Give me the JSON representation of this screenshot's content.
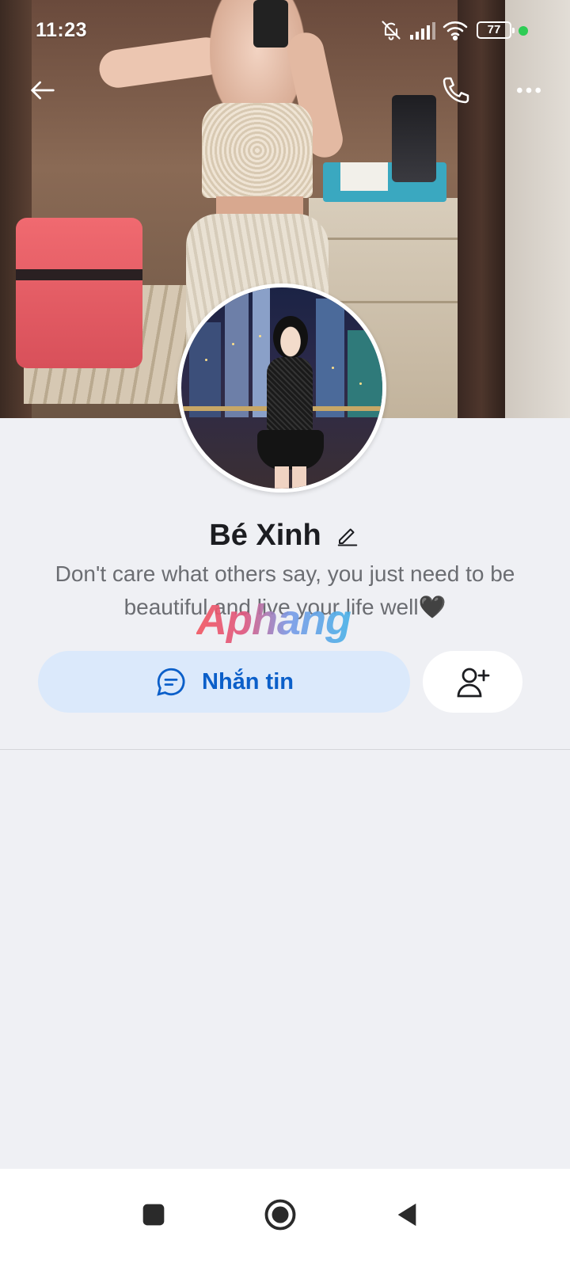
{
  "status_bar": {
    "time": "11:23",
    "battery": "77",
    "icons": [
      "bell-off-icon",
      "signal-icon",
      "wifi-icon",
      "battery-icon"
    ],
    "dot_color": "#2ecc55"
  },
  "header": {
    "icons": [
      "arrow-left-icon",
      "phone-icon",
      "more-horizontal-icon"
    ]
  },
  "profile": {
    "name": "Bé Xinh",
    "bio": "Don't care what others say, you just need to be beautiful and live your life well🖤"
  },
  "watermark": {
    "text": "Aphang"
  },
  "actions": {
    "message_label": "Nhắn tin",
    "accent_color": "#0b5fc9",
    "message_bg": "#dbe9fb",
    "add_friend_icon": "user-plus-icon"
  },
  "nav": {
    "icons": [
      "square-icon",
      "circle-icon",
      "triangle-back-icon"
    ]
  }
}
